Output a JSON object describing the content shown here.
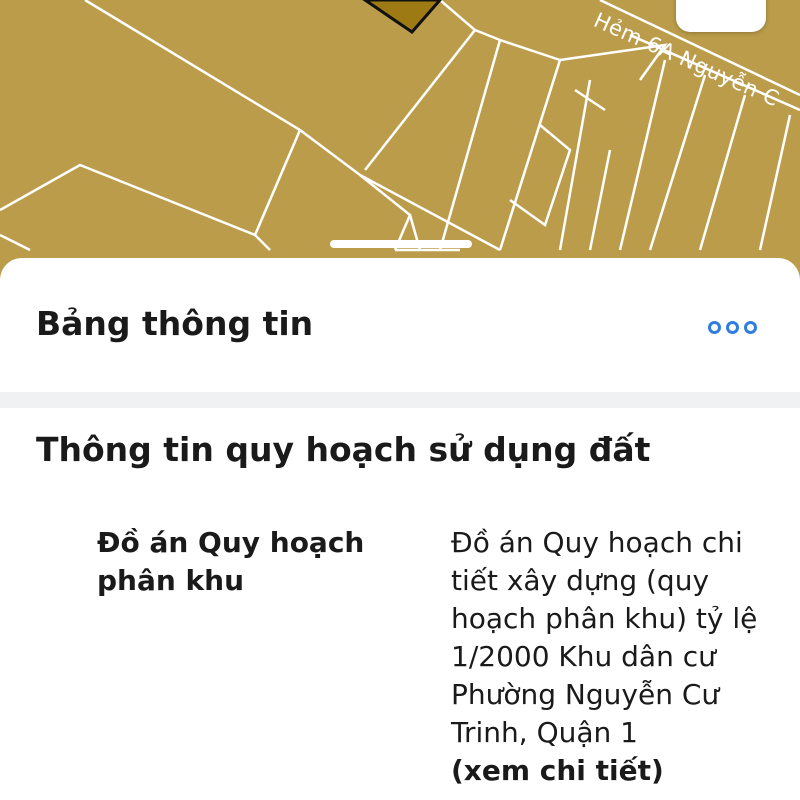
{
  "map": {
    "street_label": "Hẻm 6A Nguyễn C",
    "background_color": "#bb9c4a",
    "highlight_color": "#9e7a14"
  },
  "panel": {
    "title": "Bảng thông tin",
    "more_icon": "ellipsis-circles-icon",
    "accent_color": "#2f7de1"
  },
  "section": {
    "title": "Thông tin quy hoạch sử dụng đất",
    "rows": [
      {
        "label": "Đồ án Quy hoạch phân khu",
        "value": "Đồ án Quy hoạch chi tiết xây dựng (quy hoạch phân khu) tỷ lệ 1/2000 Khu dân cư Phường Nguyễn Cư Trinh, Quận 1",
        "link": "(xem chi tiết)"
      }
    ]
  }
}
